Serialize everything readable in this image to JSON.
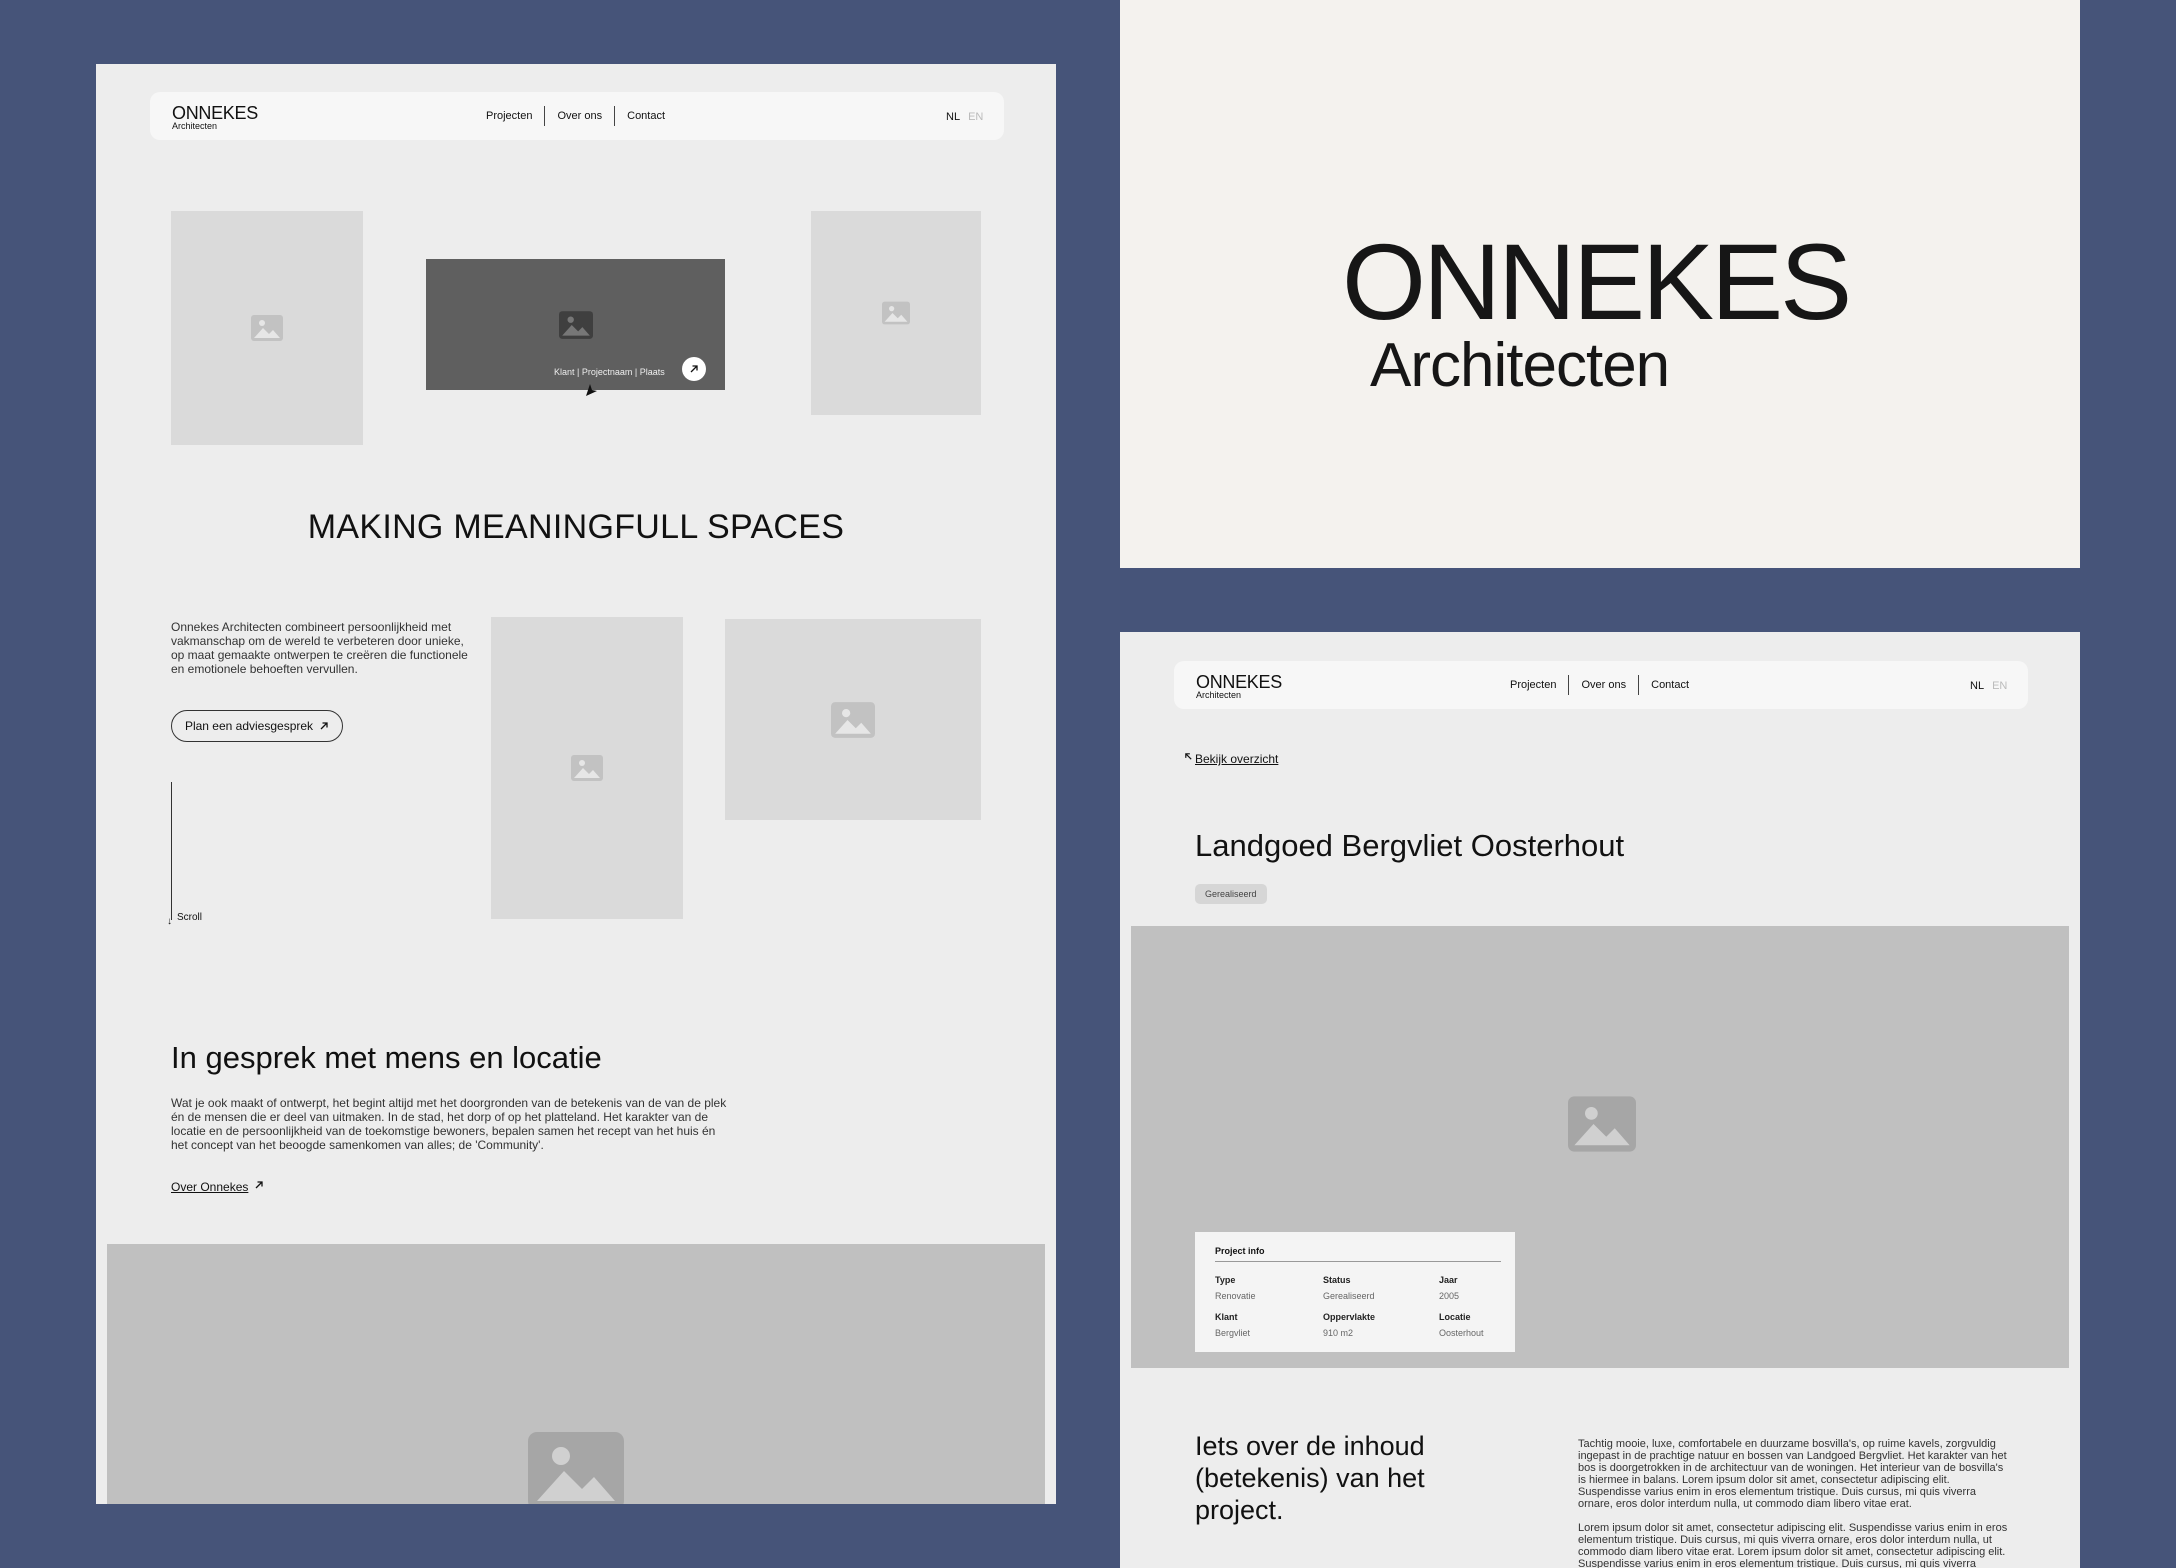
{
  "home": {
    "nav": {
      "brand": "ONNEKES",
      "brand_sub": "Architecten",
      "links": [
        "Projecten",
        "Over ons",
        "Contact"
      ],
      "lang_active": "NL",
      "lang_inactive": "EN"
    },
    "hero_caption": "Klant | Projectnaam | Plaats",
    "headline": "MAKING MEANINGFULL SPACES",
    "intro": "Onnekes Architecten combineert persoonlijkheid met vakmanschap om de wereld te verbeteren door unieke, op maat gemaakte ontwerpen te creëren die functionele en emotionele behoeften vervullen.",
    "cta_label": "Plan een adviesgesprek",
    "scroll_label": "Scroll",
    "section_title": "In gesprek met mens en locatie",
    "section_body": "Wat je ook maakt of ontwerpt, het begint altijd met het doorgronden van de betekenis van de van de plek én de mensen die er deel van uitmaken. In de stad, het dorp of op het platteland. Het karakter van de locatie en de persoonlijkheid van de toekomstige bewoners, bepalen samen het recept van het huis én het concept van het beoogde samenkomen van alles; de 'Community'.",
    "about_link": "Over Onnekes"
  },
  "logo_card": {
    "main": "ONNEKES",
    "sub": "Architecten"
  },
  "project": {
    "nav": {
      "brand": "ONNEKES",
      "brand_sub": "Architecten",
      "links": [
        "Projecten",
        "Over ons",
        "Contact"
      ],
      "lang_active": "NL",
      "lang_inactive": "EN"
    },
    "back_link": "Bekijk overzicht",
    "title": "Landgoed Bergvliet Oosterhout",
    "status_badge": "Gerealiseerd",
    "info": {
      "heading": "Project info",
      "rows": [
        {
          "label": "Type",
          "value": "Renovatie"
        },
        {
          "label": "Status",
          "value": "Gerealiseerd"
        },
        {
          "label": "Jaar",
          "value": "2005"
        },
        {
          "label": "Klant",
          "value": "Bergvliet"
        },
        {
          "label": "Oppervlakte",
          "value": "910 m2"
        },
        {
          "label": "Locatie",
          "value": "Oosterhout"
        }
      ]
    },
    "content_title": "Iets over de inhoud (betekenis) van het project.",
    "body_1": "Tachtig mooie, luxe, comfortabele en duurzame bosvilla's, op ruime kavels, zorgvuldig ingepast in de prachtige natuur en bossen van Landgoed Bergvliet. Het karakter van het bos is doorgetrokken in de architectuur van de woningen. Het interieur van de bosvilla's is hiermee in balans. Lorem ipsum dolor sit amet, consectetur adipiscing elit. Suspendisse varius enim in eros elementum tristique. Duis cursus, mi quis viverra ornare, eros dolor interdum nulla, ut commodo diam libero vitae erat.",
    "body_2": "Lorem ipsum dolor sit amet, consectetur adipiscing elit. Suspendisse varius enim in eros elementum tristique. Duis cursus, mi quis viverra ornare, eros dolor interdum nulla, ut commodo diam libero vitae erat. Lorem ipsum dolor sit amet, consectetur adipiscing elit. Suspendisse varius enim in eros elementum tristique. Duis cursus, mi quis viverra ornare,"
  },
  "colors": {
    "background": "#465479",
    "panel": "#ededed",
    "logo_card": "#f4f2ee",
    "placeholder": "#dadada",
    "placeholder_dark": "#5f5f5f",
    "hero_grey": "#c0c0c0"
  },
  "icons": [
    "image-placeholder-icon",
    "arrow-up-right-icon",
    "cursor-icon",
    "arrow-down-icon",
    "arrow-up-left-icon"
  ]
}
